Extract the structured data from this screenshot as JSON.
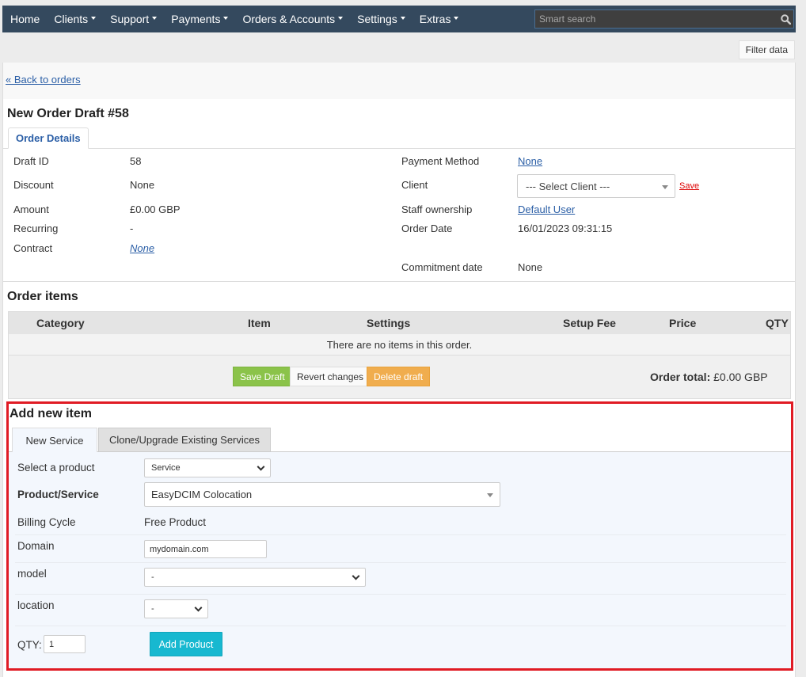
{
  "nav": {
    "items": [
      {
        "label": "Home",
        "dropdown": false
      },
      {
        "label": "Clients",
        "dropdown": true
      },
      {
        "label": "Support",
        "dropdown": true
      },
      {
        "label": "Payments",
        "dropdown": true
      },
      {
        "label": "Orders & Accounts",
        "dropdown": true
      },
      {
        "label": "Settings",
        "dropdown": true
      },
      {
        "label": "Extras",
        "dropdown": true
      }
    ],
    "search_placeholder": "Smart search",
    "search_icon": "search-icon"
  },
  "filter_button": "Filter data",
  "back_link": "« Back to orders",
  "page_title": "New Order Draft #58",
  "details_tab": "Order Details",
  "details": {
    "left": [
      {
        "label": "Draft ID",
        "value": "58"
      },
      {
        "label": "Discount",
        "value": "None"
      },
      {
        "label": "Amount",
        "value": "£0.00 GBP"
      },
      {
        "label": "Recurring",
        "value": "-"
      },
      {
        "label": "Contract",
        "value": "None"
      }
    ],
    "right": {
      "payment_method_label": "Payment Method",
      "payment_method_value": "None",
      "client_label": "Client",
      "client_select": "--- Select Client ---",
      "client_save": "Save",
      "staff_label": "Staff ownership",
      "staff_value": "Default User",
      "order_date_label": "Order Date",
      "order_date_value": "16/01/2023 09:31:15",
      "commitment_label": "Commitment date",
      "commitment_value": "None"
    }
  },
  "order_items": {
    "title": "Order items",
    "columns": [
      "Category",
      "Item",
      "Settings",
      "Setup Fee",
      "Price",
      "QTY"
    ],
    "empty_message": "There are no items in this order.",
    "buttons": {
      "save": "Save Draft",
      "revert": "Revert changes",
      "delete": "Delete draft"
    },
    "total_label": "Order total:",
    "total_value": "£0.00 GBP"
  },
  "add_item": {
    "title": "Add new item",
    "tabs": [
      "New Service",
      "Clone/Upgrade Existing Services"
    ],
    "active_tab": "New Service",
    "fields": {
      "select_product_label": "Select a product",
      "select_product_value": "Service",
      "product_service_label": "Product/Service",
      "product_service_value": "EasyDCIM Colocation",
      "billing_cycle_label": "Billing Cycle",
      "billing_cycle_value": "Free Product",
      "domain_label": "Domain",
      "domain_value": "mydomain.com",
      "model_label": "model",
      "model_value": "-",
      "location_label": "location",
      "location_value": "-",
      "qty_label": "QTY:",
      "qty_value": "1"
    },
    "add_button": "Add Product"
  },
  "colors": {
    "nav_bg": "#34495e",
    "link": "#2a5ea6",
    "save_green": "#8bc34a",
    "delete_orange": "#f0ad4e",
    "add_cyan": "#17b8d0",
    "highlight_red": "#e01b24"
  }
}
